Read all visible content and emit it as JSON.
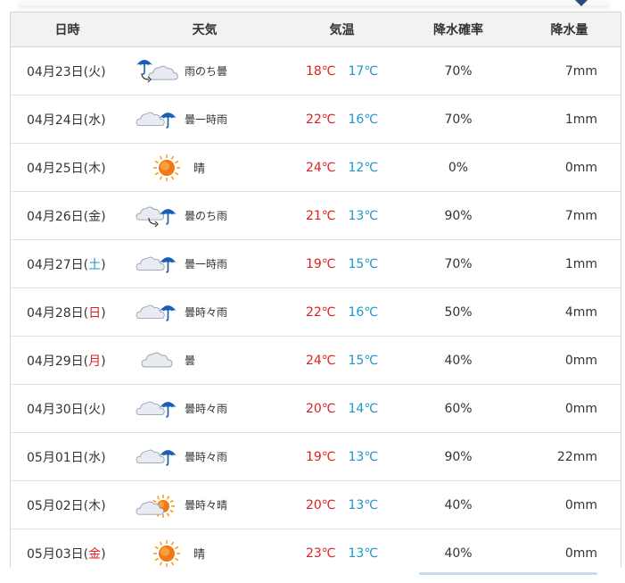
{
  "header": {
    "date": "日時",
    "weather": "天気",
    "temperature": "気温",
    "precip_prob": "降水確率",
    "precip_amount": "降水量"
  },
  "rows": [
    {
      "date": "04月23日(",
      "weekday": "火",
      "weekday_color": "normal",
      "close": ")",
      "icon": "rain-then-cloudy-icon",
      "weather": "雨のち曇",
      "high": "18℃",
      "low": "17℃",
      "prob": "70%",
      "amount": "7mm"
    },
    {
      "date": "04月24日(",
      "weekday": "水",
      "weekday_color": "normal",
      "close": ")",
      "icon": "cloudy-occasional-rain-icon",
      "weather": "曇一時雨",
      "high": "22℃",
      "low": "16℃",
      "prob": "70%",
      "amount": "1mm"
    },
    {
      "date": "04月25日(",
      "weekday": "木",
      "weekday_color": "normal",
      "close": ")",
      "icon": "sunny-icon",
      "weather": "晴",
      "high": "24℃",
      "low": "12℃",
      "prob": "0%",
      "amount": "0mm"
    },
    {
      "date": "04月26日(",
      "weekday": "金",
      "weekday_color": "normal",
      "close": ")",
      "icon": "cloudy-then-rain-icon",
      "weather": "曇のち雨",
      "high": "21℃",
      "low": "13℃",
      "prob": "90%",
      "amount": "7mm"
    },
    {
      "date": "04月27日(",
      "weekday": "土",
      "weekday_color": "blue",
      "close": ")",
      "icon": "cloudy-occasional-rain-icon",
      "weather": "曇一時雨",
      "high": "19℃",
      "low": "15℃",
      "prob": "70%",
      "amount": "1mm"
    },
    {
      "date": "04月28日(",
      "weekday": "日",
      "weekday_color": "red",
      "close": ")",
      "icon": "cloudy-sometimes-rain-icon",
      "weather": "曇時々雨",
      "high": "22℃",
      "low": "16℃",
      "prob": "50%",
      "amount": "4mm"
    },
    {
      "date": "04月29日(",
      "weekday": "月",
      "weekday_color": "red",
      "close": ")",
      "icon": "cloudy-icon",
      "weather": "曇",
      "high": "24℃",
      "low": "15℃",
      "prob": "40%",
      "amount": "0mm"
    },
    {
      "date": "04月30日(",
      "weekday": "火",
      "weekday_color": "normal",
      "close": ")",
      "icon": "cloudy-sometimes-rain-icon",
      "weather": "曇時々雨",
      "high": "20℃",
      "low": "14℃",
      "prob": "60%",
      "amount": "0mm"
    },
    {
      "date": "05月01日(",
      "weekday": "水",
      "weekday_color": "normal",
      "close": ")",
      "icon": "cloudy-sometimes-rain-icon",
      "weather": "曇時々雨",
      "high": "19℃",
      "low": "13℃",
      "prob": "90%",
      "amount": "22mm"
    },
    {
      "date": "05月02日(",
      "weekday": "木",
      "weekday_color": "normal",
      "close": ")",
      "icon": "cloudy-sometimes-sunny-icon",
      "weather": "曇時々晴",
      "high": "20℃",
      "low": "13℃",
      "prob": "40%",
      "amount": "0mm"
    },
    {
      "date": "05月03日(",
      "weekday": "金",
      "weekday_color": "red",
      "close": ")",
      "icon": "sunny-icon",
      "weather": "晴",
      "high": "23℃",
      "low": "13℃",
      "prob": "40%",
      "amount": "0mm"
    }
  ],
  "colors": {
    "high_temp": "#e02020",
    "low_temp": "#1e96c8",
    "saturday": "#1e96c8",
    "holiday": "#e02020",
    "header_bg": "#f2f2f2",
    "umbrella": "#1a5fb4",
    "sun": "#f07818"
  }
}
